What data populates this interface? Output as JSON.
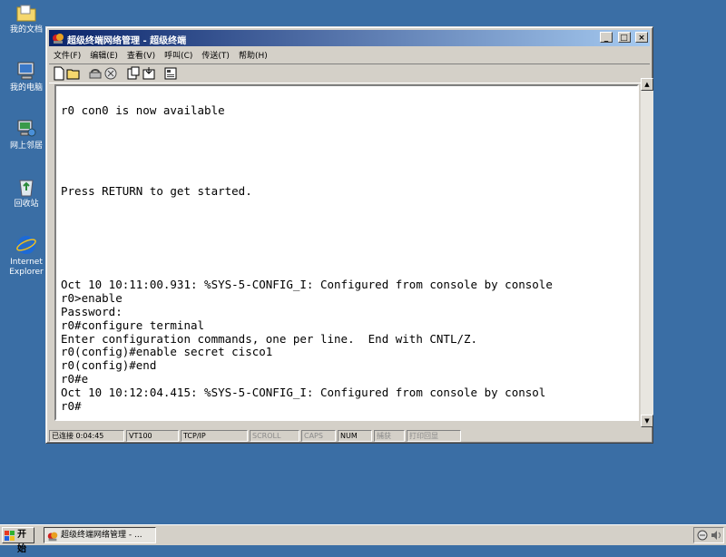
{
  "desktop": {
    "icons": [
      {
        "label": "我的文档",
        "icon": "folder-icon"
      },
      {
        "label": "我的电脑",
        "icon": "computer-icon"
      },
      {
        "label": "网上邻居",
        "icon": "network-icon"
      },
      {
        "label": "回收站",
        "icon": "recycle-bin-icon"
      },
      {
        "label": "Internet Explorer",
        "icon": "ie-icon"
      }
    ]
  },
  "window": {
    "title": "超级终端网络管理 - 超级终端",
    "controls": {
      "minimize": "_",
      "maximize": "□",
      "close": "×"
    },
    "menu": [
      "文件(F)",
      "编辑(E)",
      "查看(V)",
      "呼叫(C)",
      "传送(T)",
      "帮助(H)"
    ],
    "toolbar": [
      "new-icon",
      "open-icon",
      "disconnect-icon",
      "dial-icon",
      "send-icon",
      "receive-icon",
      "properties-icon"
    ]
  },
  "terminal": {
    "lines": [
      "r0 con0 is now available",
      "",
      "",
      "",
      "",
      "",
      "Press RETURN to get started.",
      "",
      "",
      "",
      "",
      "",
      "",
      "Oct 10 10:11:00.931: %SYS-5-CONFIG_I: Configured from console by console",
      "r0>enable",
      "Password:",
      "r0#configure terminal",
      "Enter configuration commands, one per line.  End with CNTL/Z.",
      "r0(config)#enable secret cisco1",
      "r0(config)#end",
      "r0#e",
      "Oct 10 10:12:04.415: %SYS-5-CONFIG_I: Configured from console by consol",
      "r0#"
    ]
  },
  "status": {
    "connection": "已连接 0:04:45",
    "emulation": "VT100",
    "protocol": "TCP/IP",
    "scroll": "SCROLL",
    "caps": "CAPS",
    "num": "NUM",
    "capture": "捕获",
    "print_echo": "打印回显"
  },
  "taskbar": {
    "start": "开始",
    "task": "超级终端网络管理 - ..."
  },
  "colors": {
    "desktop": "#3a6ea5",
    "title_start": "#0a246a",
    "title_end": "#a6caf0",
    "chrome": "#d4d0c8"
  }
}
